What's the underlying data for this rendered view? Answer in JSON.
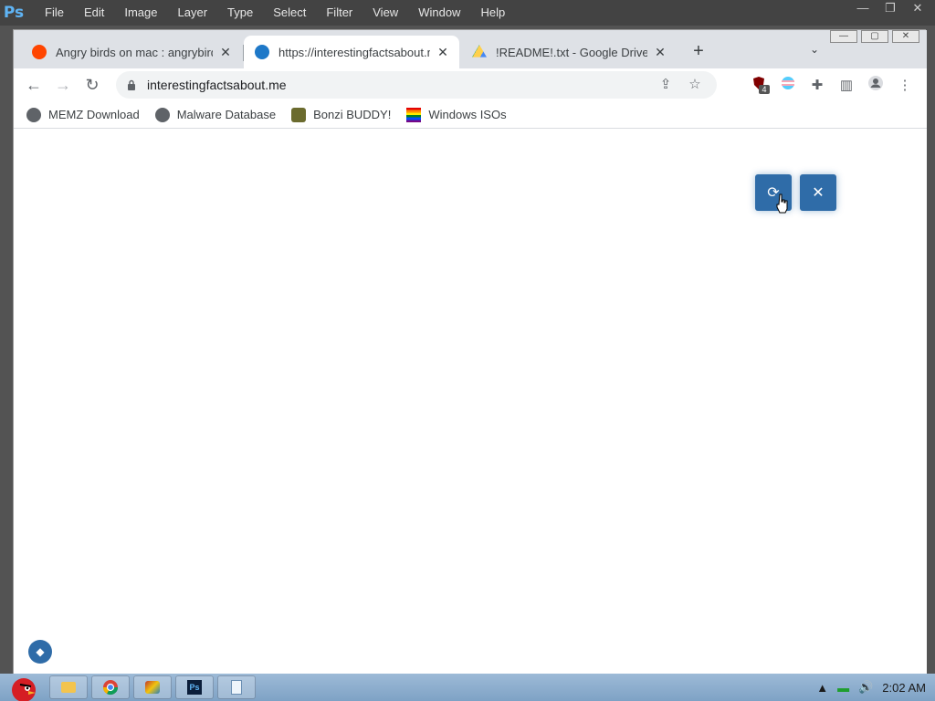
{
  "photoshop": {
    "logo": "Ps",
    "menu": [
      "File",
      "Edit",
      "Image",
      "Layer",
      "Type",
      "Select",
      "Filter",
      "View",
      "Window",
      "Help"
    ]
  },
  "browser": {
    "tabs": [
      {
        "title": "Angry birds on mac : angrybirds",
        "icon": "reddit-icon",
        "active": false
      },
      {
        "title": "https://interestingfactsabout.me",
        "icon": "site-globe-icon",
        "active": true
      },
      {
        "title": "!README!.txt - Google Drive",
        "icon": "google-drive-icon",
        "active": false
      }
    ],
    "address": "interestingfactsabout.me",
    "bookmarks": [
      {
        "label": "MEMZ Download",
        "icon": "globe-icon"
      },
      {
        "label": "Malware Database",
        "icon": "globe-icon"
      },
      {
        "label": "Bonzi BUDDY!",
        "icon": "bonzi-icon"
      },
      {
        "label": "Windows ISOs",
        "icon": "rainbow-flag-icon"
      }
    ],
    "extension_badge": "4"
  },
  "page": {
    "reload_button_icon": "refresh-icon",
    "close_button_icon": "close-icon",
    "accent_color": "#2f6ca8"
  },
  "taskbar": {
    "clock": "2:02 AM",
    "apps": [
      "explorer-icon",
      "chrome-icon",
      "paint-icon",
      "photoshop-icon",
      "notepad-icon"
    ]
  }
}
